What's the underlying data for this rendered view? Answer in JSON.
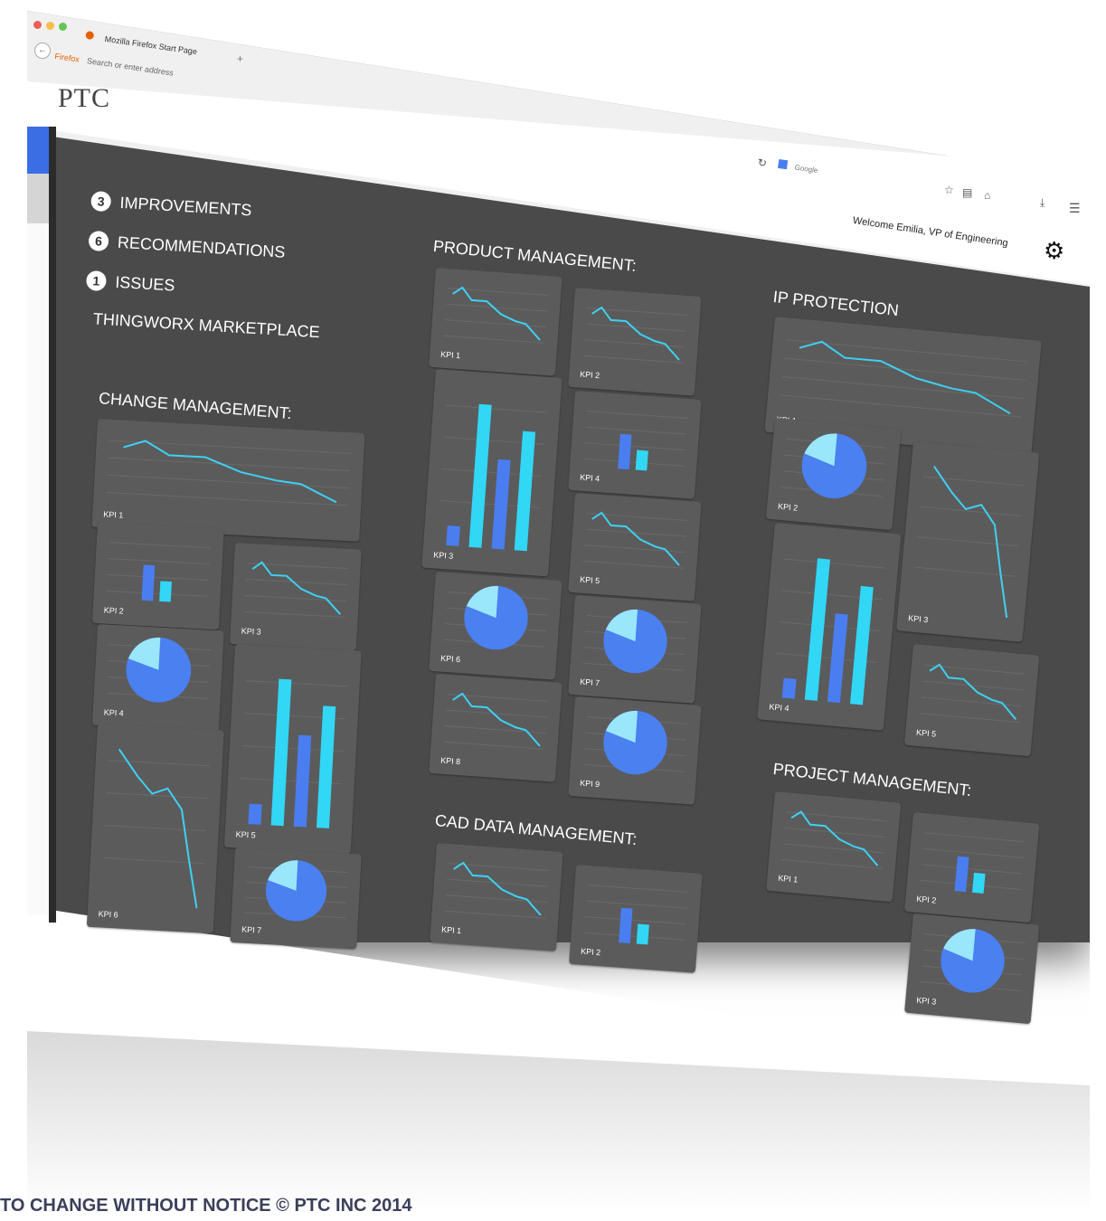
{
  "browser": {
    "tab_title": "Mozilla Firefox Start Page",
    "new_tab": "+",
    "address_brand": "Firefox",
    "address_placeholder": "Search or enter address",
    "search_engine": "Google"
  },
  "header": {
    "logo": "PTC",
    "welcome": "Welcome Emilia, VP of Engineering",
    "gear_icon": "gear-icon"
  },
  "summary": [
    {
      "count": "3",
      "label": "IMPROVEMENTS"
    },
    {
      "count": "6",
      "label": "RECOMMENDATIONS"
    },
    {
      "count": "1",
      "label": "ISSUES"
    }
  ],
  "marketplace": "THINGWORX MARKETPLACE",
  "sections": {
    "change": {
      "title": "CHANGE MANAGEMENT:",
      "kpis": [
        "KPI 1",
        "KPI 2",
        "KPI 3",
        "KPI 4",
        "KPI 5",
        "KPI 6",
        "KPI 7"
      ]
    },
    "product": {
      "title": "PRODUCT MANAGEMENT:",
      "kpis": [
        "KPI 1",
        "KPI 2",
        "KPI 3",
        "KPI 4",
        "KPI 5",
        "KPI 6",
        "KPI 7",
        "KPI 8",
        "KPI 9"
      ]
    },
    "cad": {
      "title": "CAD DATA MANAGEMENT:",
      "kpis": [
        "KPI 1",
        "KPI 2"
      ]
    },
    "ip": {
      "title": "IP PROTECTION",
      "kpis": [
        "KPI 1",
        "KPI 2",
        "KPI 3",
        "KPI 4",
        "KPI 5"
      ]
    },
    "project": {
      "title": "PROJECT MANAGEMENT:",
      "kpis": [
        "KPI 1",
        "KPI 2",
        "KPI 3"
      ]
    }
  },
  "colors": {
    "panel_bg": "#4a4a4b",
    "tile_bg": "#5b5b5c",
    "line": "#3fd0f0",
    "bar_light": "#31d7f5",
    "bar_dark": "#4a7ef0",
    "pie_main": "#4a80f0",
    "pie_light": "#9ae6fb",
    "pie_cyan": "#5fe0fa"
  },
  "footer": "TO CHANGE WITHOUT NOTICE © PTC INC 2014"
}
